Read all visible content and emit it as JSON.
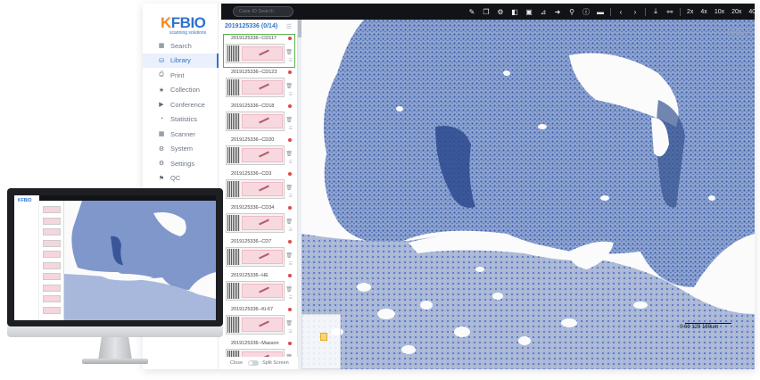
{
  "brand": {
    "logo_k": "K",
    "logo_rest": "FBIO",
    "tagline": "scanning solutions"
  },
  "nav": [
    {
      "label": "Search",
      "icon": "grid-icon",
      "glyph": "▦"
    },
    {
      "label": "Library",
      "icon": "database-icon",
      "glyph": "⛁"
    },
    {
      "label": "Print",
      "icon": "print-icon",
      "glyph": "⎙"
    },
    {
      "label": "Collection",
      "icon": "star-icon",
      "glyph": "★"
    },
    {
      "label": "Conference",
      "icon": "video-icon",
      "glyph": "▶"
    },
    {
      "label": "Statistics",
      "icon": "pie-chart-icon",
      "glyph": "◔"
    },
    {
      "label": "Scanner",
      "icon": "grid-icon",
      "glyph": "▦"
    },
    {
      "label": "System",
      "icon": "gear-icon",
      "glyph": "⚙"
    },
    {
      "label": "Settings",
      "icon": "gear-icon",
      "glyph": "⚙"
    },
    {
      "label": "QC",
      "icon": "flag-icon",
      "glyph": "⚑"
    }
  ],
  "toolbar": {
    "search_placeholder": "Case ID Search",
    "tools": [
      {
        "icon": "pen-icon",
        "glyph": "✎"
      },
      {
        "icon": "copy-icon",
        "glyph": "❐"
      },
      {
        "icon": "gear-icon",
        "glyph": "⚙"
      },
      {
        "icon": "layers-icon",
        "glyph": "◧"
      },
      {
        "icon": "image-icon",
        "glyph": "▣"
      },
      {
        "icon": "measure-icon",
        "glyph": "⊿"
      },
      {
        "icon": "arrow-right-icon",
        "glyph": "➜"
      },
      {
        "icon": "location-pin-icon",
        "glyph": "⚲"
      },
      {
        "icon": "info-icon",
        "glyph": "ⓘ"
      },
      {
        "icon": "screen-icon",
        "glyph": "▬"
      },
      {
        "icon": "chevron-left-icon",
        "glyph": "‹"
      },
      {
        "icon": "chevron-right-icon",
        "glyph": "›"
      },
      {
        "icon": "download-icon",
        "glyph": "⤓"
      },
      {
        "icon": "share-icon",
        "glyph": "⚯"
      }
    ],
    "zooms": [
      "2x",
      "4x",
      "10x",
      "20x",
      "40x"
    ],
    "current_zoom": "6.27"
  },
  "slide_list": {
    "case_header": "2019125336 (0/14)",
    "slides": [
      {
        "name": "2019125336--CD117"
      },
      {
        "name": "2019125336--CD123"
      },
      {
        "name": "2019125336--CD18"
      },
      {
        "name": "2019125336--CD20"
      },
      {
        "name": "2019125336--CD3"
      },
      {
        "name": "2019125336--CD34"
      },
      {
        "name": "2019125336--CD7"
      },
      {
        "name": "2019125336--HE"
      },
      {
        "name": "2019125336--Ki-67"
      },
      {
        "name": "2019125336--Masson"
      }
    ],
    "footer_close": "Close",
    "footer_split": "Split Screen"
  },
  "viewer": {
    "slide_label": "CD117",
    "scale_labels": "0   60  120 180um"
  },
  "colors": {
    "accent": "#2f73c9",
    "logo_k": "#f08a24",
    "selected_outline": "#59b34a",
    "stain": "#3c63a8"
  }
}
